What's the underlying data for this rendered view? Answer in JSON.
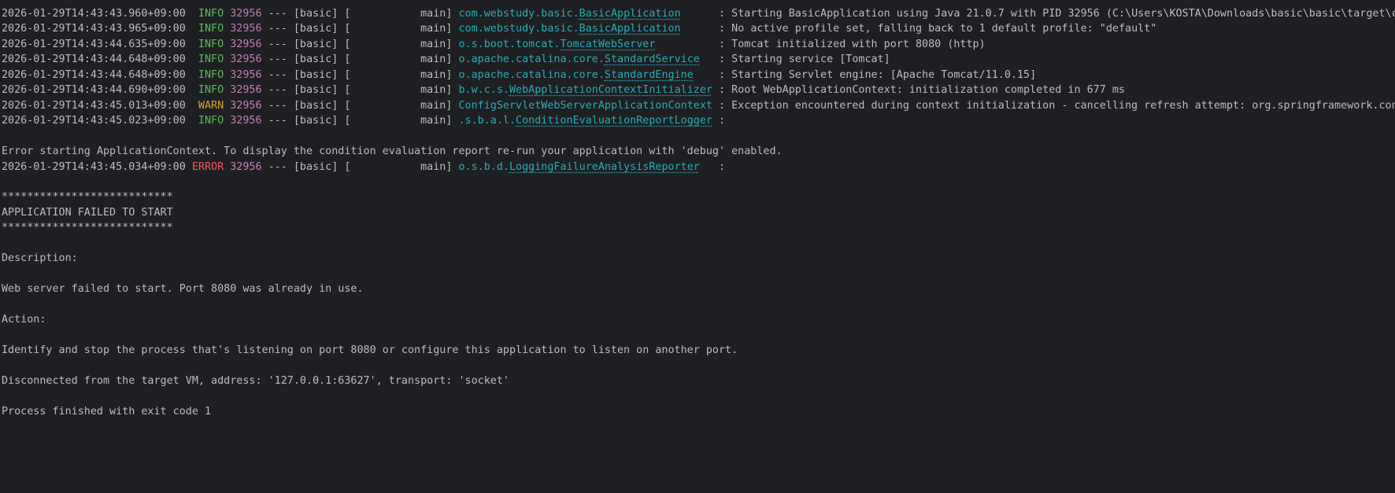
{
  "console": {
    "log_entries": [
      {
        "timestamp": "2026-01-29T14:43:43.960+09:00",
        "level": "INFO",
        "pid": "32956",
        "sep": "---",
        "app": "[basic]",
        "thread": "[           main]",
        "logger_prefix": "com.webstudy.basic.",
        "logger_class": "BasicApplication",
        "logger_pad": "      ",
        "message": ": Starting BasicApplication using Java 21.0.7 with PID 32956 (C:\\Users\\KOSTA\\Downloads\\basic\\basic\\target\\cla"
      },
      {
        "timestamp": "2026-01-29T14:43:43.965+09:00",
        "level": "INFO",
        "pid": "32956",
        "sep": "---",
        "app": "[basic]",
        "thread": "[           main]",
        "logger_prefix": "com.webstudy.basic.",
        "logger_class": "BasicApplication",
        "logger_pad": "      ",
        "message": ": No active profile set, falling back to 1 default profile: \"default\""
      },
      {
        "timestamp": "2026-01-29T14:43:44.635+09:00",
        "level": "INFO",
        "pid": "32956",
        "sep": "---",
        "app": "[basic]",
        "thread": "[           main]",
        "logger_prefix": "o.s.boot.tomcat.",
        "logger_class": "TomcatWebServer",
        "logger_pad": "          ",
        "message": ": Tomcat initialized with port 8080 (http)"
      },
      {
        "timestamp": "2026-01-29T14:43:44.648+09:00",
        "level": "INFO",
        "pid": "32956",
        "sep": "---",
        "app": "[basic]",
        "thread": "[           main]",
        "logger_prefix": "o.apache.catalina.core.",
        "logger_class": "StandardService",
        "logger_pad": "   ",
        "message": ": Starting service [Tomcat]"
      },
      {
        "timestamp": "2026-01-29T14:43:44.648+09:00",
        "level": "INFO",
        "pid": "32956",
        "sep": "---",
        "app": "[basic]",
        "thread": "[           main]",
        "logger_prefix": "o.apache.catalina.core.",
        "logger_class": "StandardEngine",
        "logger_pad": "    ",
        "message": ": Starting Servlet engine: [Apache Tomcat/11.0.15]"
      },
      {
        "timestamp": "2026-01-29T14:43:44.690+09:00",
        "level": "INFO",
        "pid": "32956",
        "sep": "---",
        "app": "[basic]",
        "thread": "[           main]",
        "logger_prefix": "b.w.c.s.",
        "logger_class": "WebApplicationContextInitializer",
        "logger_pad": " ",
        "message": ": Root WebApplicationContext: initialization completed in 677 ms"
      },
      {
        "timestamp": "2026-01-29T14:43:45.013+09:00",
        "level": "WARN",
        "pid": "32956",
        "sep": "---",
        "app": "[basic]",
        "thread": "[           main]",
        "logger_prefix": "ConfigServletWebServerApplicationContext",
        "logger_class": "",
        "logger_pad": " ",
        "message": ": Exception encountered during context initialization - cancelling refresh attempt: org.springframework.conte"
      },
      {
        "timestamp": "2026-01-29T14:43:45.023+09:00",
        "level": "INFO",
        "pid": "32956",
        "sep": "---",
        "app": "[basic]",
        "thread": "[           main]",
        "logger_prefix": ".s.b.a.l.",
        "logger_class": "ConditionEvaluationReportLogger",
        "logger_pad": " ",
        "message": ":"
      }
    ],
    "error_context_line": "Error starting ApplicationContext. To display the condition evaluation report re-run your application with 'debug' enabled.",
    "error_entry": {
      "timestamp": "2026-01-29T14:43:45.034+09:00",
      "level": "ERROR",
      "pid": "32956",
      "sep": "---",
      "app": "[basic]",
      "thread": "[           main]",
      "logger_prefix": "o.s.b.d.",
      "logger_class": "LoggingFailureAnalysisReporter",
      "logger_pad": "   ",
      "message": ":"
    },
    "banner_stars_top": "***************************",
    "banner_title": "APPLICATION FAILED TO START",
    "banner_stars_bottom": "***************************",
    "description_label": "Description:",
    "description_text": "Web server failed to start. Port 8080 was already in use.",
    "action_label": "Action:",
    "action_text": "Identify and stop the process that's listening on port 8080 or configure this application to listen on another port.",
    "disconnected_text": "Disconnected from the target VM, address: '127.0.0.1:63627', transport: 'socket'",
    "exit_text": "Process finished with exit code 1",
    "colors": {
      "background": "#1e1f22",
      "text": "#bcbec4",
      "info": "#5fb760",
      "warn": "#d6a33b",
      "error": "#f75464",
      "pid": "#c77dbb",
      "logger": "#2aacb8"
    }
  }
}
